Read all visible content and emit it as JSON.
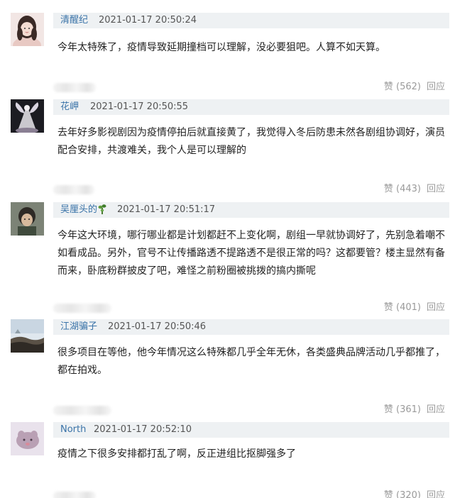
{
  "comments": [
    {
      "username": "清醒纪",
      "timestamp": "2021-01-17 20:50:24",
      "text": "今年太特殊了，疫情导致延期撞档可以理解，没必要狙吧。人算不如天算。",
      "like_label": "赞 (562)",
      "reply_label": "回应"
    },
    {
      "username": "花岬",
      "timestamp": "2021-01-17 20:50:55",
      "text": "去年好多影视剧因为疫情停拍后就直接黄了，我觉得入冬后防患未然各剧组协调好，演员配合安排，共渡难关，我个人是可以理解的",
      "like_label": "赞 (443)",
      "reply_label": "回应"
    },
    {
      "username": "吴厘头的",
      "timestamp": "2021-01-17 20:51:17",
      "text": "今年这大环境，哪行哪业都是计划都赶不上变化啊，剧组一早就协调好了，先别急着嘲不如看成品。另外，官号不让传播路透不提路透不是很正常的吗？这都要管？楼主显然有备而来，卧底粉群披皮了吧，难怪之前粉圈被挑拨的搞内撕呢",
      "like_label": "赞 (401)",
      "reply_label": "回应"
    },
    {
      "username": "江湖骗子",
      "timestamp": "2021-01-17 20:50:46",
      "text": "很多项目在等他，他今年情况这么特殊都几乎全年无休，各类盛典品牌活动几乎都推了，都在拍戏。",
      "like_label": "赞 (361)",
      "reply_label": "回应"
    },
    {
      "username": "North",
      "timestamp": "2021-01-17 20:52:10",
      "text": "疫情之下很多安排都打乱了啊，反正进组比抠脚强多了",
      "like_label": "赞 (320)",
      "reply_label": "回应"
    }
  ],
  "colors": {
    "username": "#3a73a8",
    "meta_bar_bg": "#eef1f3",
    "muted": "#9a9a9a"
  },
  "icons": [
    "user-avatar",
    "plant-badge-icon"
  ]
}
